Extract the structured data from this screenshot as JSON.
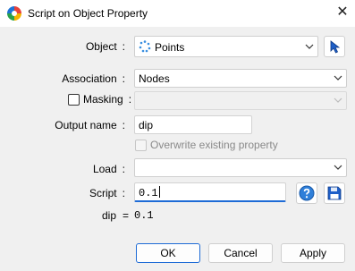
{
  "window": {
    "title": "Script on Object Property",
    "icons": {
      "app": "app-logo-icon",
      "close": "close-icon"
    }
  },
  "form": {
    "object": {
      "label": "Object",
      "value": "Points",
      "icon": "points-dots-icon",
      "picker_icon": "cursor-pick-icon"
    },
    "association": {
      "label": "Association",
      "value": "Nodes"
    },
    "masking": {
      "label": "Masking",
      "value": ""
    },
    "output_name": {
      "label": "Output name",
      "value": "dip"
    },
    "overwrite": {
      "label": "Overwrite existing property"
    },
    "load": {
      "label": "Load",
      "value": ""
    },
    "script": {
      "label": "Script",
      "value": "0.1",
      "help_icon": "help-icon",
      "save_icon": "save-icon"
    },
    "result": {
      "name": "dip",
      "equals": "=",
      "value": "0.1"
    },
    "colon": ":"
  },
  "buttons": {
    "ok": "OK",
    "cancel": "Cancel",
    "apply": "Apply"
  },
  "colors": {
    "accent": "#1e6bd6",
    "background": "#f0f0f0"
  }
}
